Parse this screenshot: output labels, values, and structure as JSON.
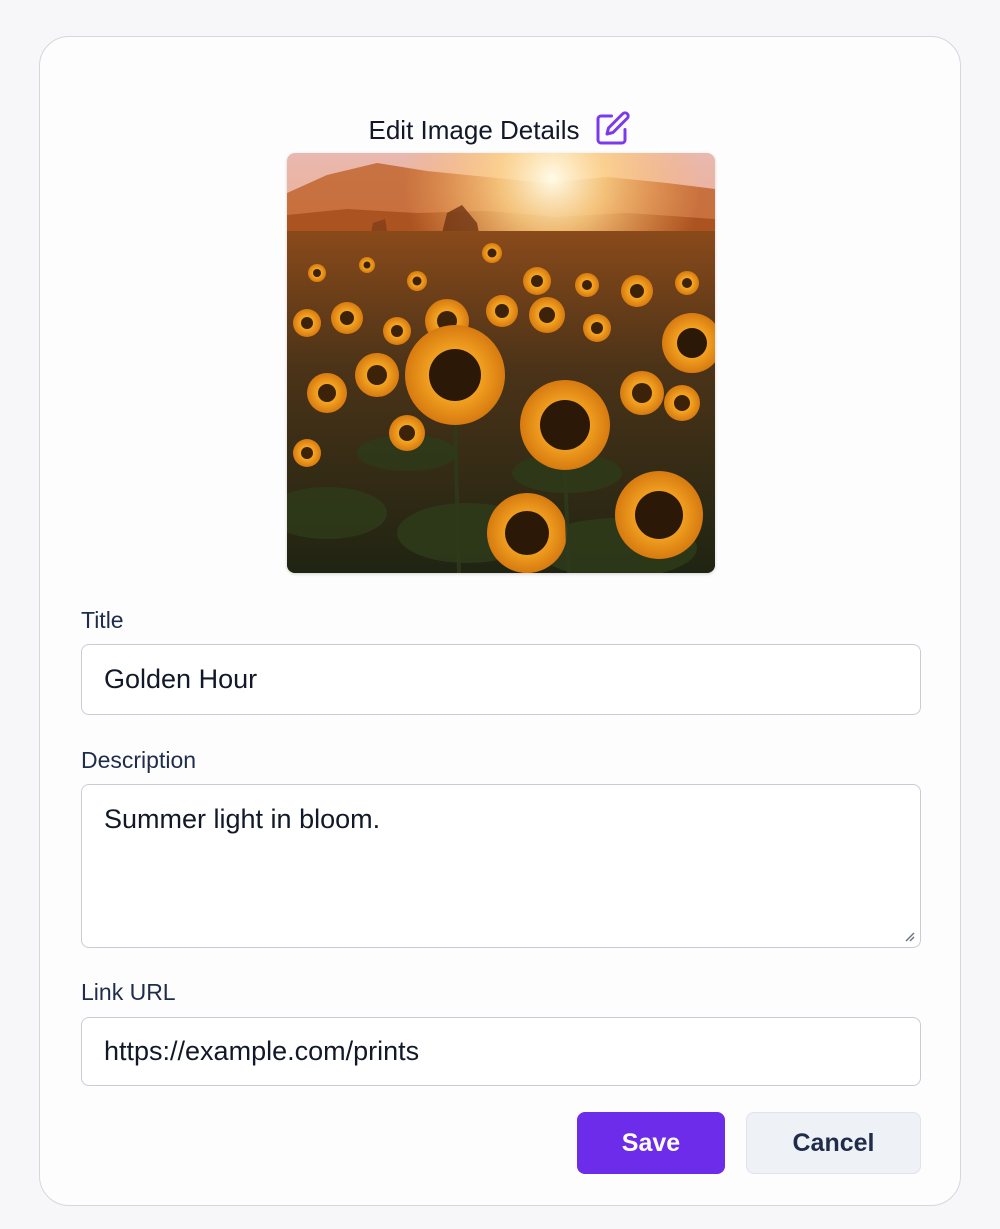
{
  "dialog": {
    "title": "Edit Image Details",
    "edit_icon": "pencil-square-icon",
    "accent_color": "#6d2bea"
  },
  "form": {
    "title_label": "Title",
    "title_value": "Golden Hour",
    "description_label": "Description",
    "description_value": "Summer light in bloom.",
    "link_label": "Link URL",
    "link_value": "https://example.com/prints"
  },
  "actions": {
    "save_label": "Save",
    "cancel_label": "Cancel"
  }
}
